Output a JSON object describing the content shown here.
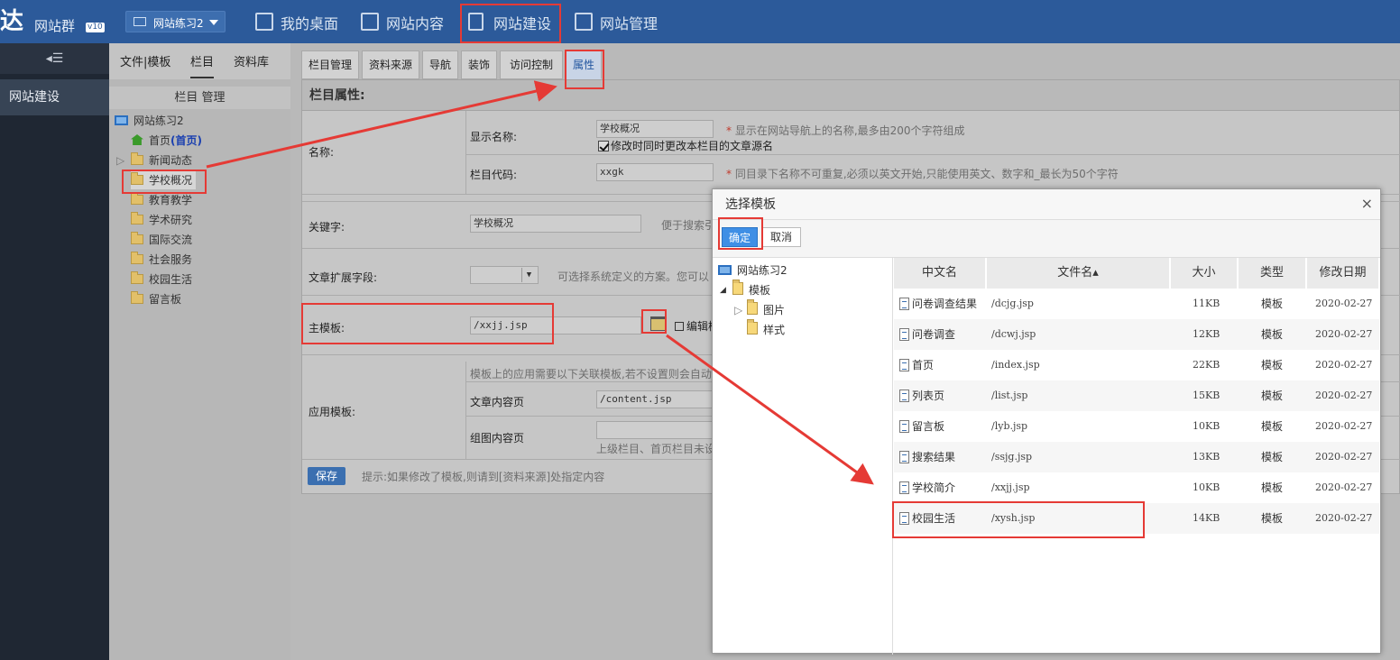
{
  "brand": {
    "logo_glyph": "达",
    "name": "网站群",
    "version": "v10"
  },
  "site_selector": {
    "value": "网站练习2"
  },
  "topnav": [
    {
      "label": "我的桌面"
    },
    {
      "label": "网站内容"
    },
    {
      "label": "网站建设"
    },
    {
      "label": "网站管理"
    }
  ],
  "leftnav": {
    "toggle": "◂☰",
    "item": "网站建设"
  },
  "midpanel": {
    "tabs": [
      "文件|模板",
      "栏目",
      "资料库"
    ],
    "title": "栏目 管理",
    "tree": {
      "root": "网站练习2",
      "home": "首页",
      "home_tag": "(首页)",
      "items": [
        "新闻动态",
        "学校概况",
        "教育教学",
        "学术研究",
        "国际交流",
        "社会服务",
        "校园生活",
        "留言板"
      ]
    }
  },
  "content_tabs": [
    "栏目管理",
    "资料来源",
    "导航",
    "装饰",
    "访问控制",
    "属性"
  ],
  "form": {
    "header": "栏目属性:",
    "name_label": "名称:",
    "display_name_label": "显示名称:",
    "display_name_value": "学校概况",
    "display_name_hint": "显示在网站导航上的名称,最多由200个字符组成",
    "checkbox_label": "修改时同时更改本栏目的文章源名",
    "code_label": "栏目代码:",
    "code_value": "xxgk",
    "code_hint": "同目录下名称不可重复,必须以英文开始,只能使用英文、数字和_最长为50个字符",
    "keyword_label": "关键字:",
    "keyword_value": "学校概况",
    "keyword_hint": "便于搜索引",
    "ext_label": "文章扩展字段:",
    "ext_hint": "可选择系统定义的方案。您可以",
    "main_tpl_label": "主模板:",
    "main_tpl_value": "/xxjj.jsp",
    "edit_label": "编辑模",
    "apply_label": "应用模板:",
    "apply_hint": "模板上的应用需要以下关联模板,若不设置则会自动",
    "article_label": "文章内容页",
    "article_value": "/content.jsp",
    "gallery_label": "组图内容页",
    "gallery_hint": "上级栏目、首页栏目未设",
    "save": "保存",
    "tip": "提示:如果修改了模板,则请到[资料来源]处指定内容"
  },
  "dialog": {
    "title": "选择模板",
    "close": "×",
    "ok": "确定",
    "cancel": "取消",
    "tree": {
      "root": "网站练习2",
      "templates": "模板",
      "images": "图片",
      "styles": "样式"
    },
    "columns": [
      "中文名",
      "文件名▴",
      "大小",
      "类型",
      "修改日期"
    ],
    "rows": [
      {
        "name": "问卷调查结果",
        "file": "/dcjg.jsp",
        "size": "11KB",
        "type": "模板",
        "date": "2020-02-27"
      },
      {
        "name": "问卷调查",
        "file": "/dcwj.jsp",
        "size": "12KB",
        "type": "模板",
        "date": "2020-02-27"
      },
      {
        "name": "首页",
        "file": "/index.jsp",
        "size": "22KB",
        "type": "模板",
        "date": "2020-02-27"
      },
      {
        "name": "列表页",
        "file": "/list.jsp",
        "size": "15KB",
        "type": "模板",
        "date": "2020-02-27"
      },
      {
        "name": "留言板",
        "file": "/lyb.jsp",
        "size": "10KB",
        "type": "模板",
        "date": "2020-02-27"
      },
      {
        "name": "搜索结果",
        "file": "/ssjg.jsp",
        "size": "13KB",
        "type": "模板",
        "date": "2020-02-27"
      },
      {
        "name": "学校简介",
        "file": "/xxjj.jsp",
        "size": "10KB",
        "type": "模板",
        "date": "2020-02-27"
      },
      {
        "name": "校园生活",
        "file": "/xysh.jsp",
        "size": "14KB",
        "type": "模板",
        "date": "2020-02-27"
      }
    ]
  },
  "colors": {
    "topbar": "#2c5a9a",
    "annotation": "#e53a35",
    "accent": "#3f8fe5"
  }
}
